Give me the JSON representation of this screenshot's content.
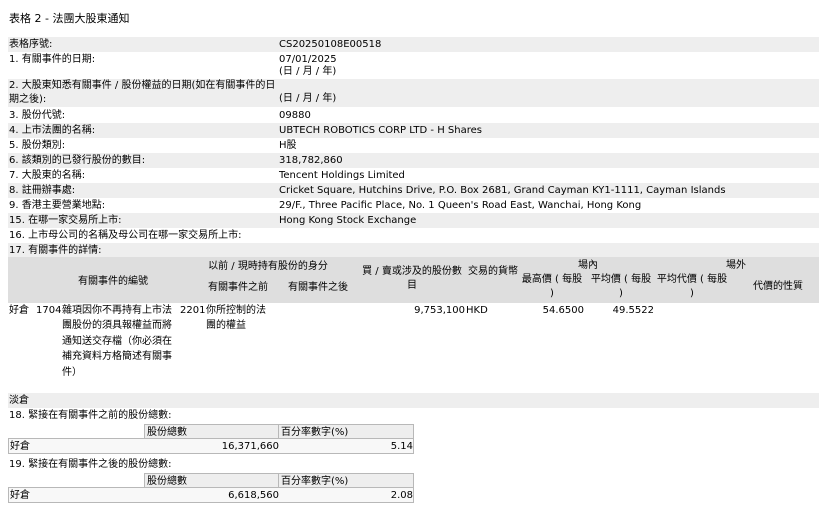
{
  "form_title": "表格 2 - 法團大股東通知",
  "fields": [
    {
      "label": "表格序號:",
      "value": "CS20250108E00518"
    },
    {
      "label": "1. 有關事件的日期:",
      "value": "07/01/2025",
      "sub": "(日 / 月 / 年)"
    },
    {
      "label": "2. 大股東知悉有關事件 / 股份權益的日期(如在有關事件的日期之後):",
      "value": "(日 / 月 / 年)"
    },
    {
      "label": "3. 股份代號:",
      "value": "09880"
    },
    {
      "label": "4. 上市法團的名稱:",
      "value": "UBTECH ROBOTICS CORP LTD - H Shares"
    },
    {
      "label": "5. 股份類別:",
      "value": "H股"
    },
    {
      "label": "6. 該類別的已發行股份的數目:",
      "value": "318,782,860"
    },
    {
      "label": "7. 大股東的名稱:",
      "value": "Tencent Holdings Limited"
    },
    {
      "label": "8. 註冊辦事處:",
      "value": "Cricket Square, Hutchins Drive, P.O. Box 2681, Grand Cayman KY1-1111, Cayman Islands"
    },
    {
      "label": "9. 香港主要營業地點:",
      "value": "29/F., Three Pacific Place, No. 1 Queen's Road East, Wanchai, Hong Kong"
    },
    {
      "label": "15. 在哪一家交易所上市:",
      "value": "Hong Kong Stock Exchange"
    },
    {
      "label": "16. 上市母公司的名稱及母公司在哪一家交易所上市:",
      "value": ""
    },
    {
      "label": "17. 有關事件的詳情:",
      "value": ""
    }
  ],
  "event_table": {
    "headers": {
      "event_code": "有關事件的編號",
      "capacity_group": "以前 / 現時持有股份的身分",
      "before": "有關事件之前",
      "after": "有關事件之後",
      "shares_involved": "買 / 賣或涉及的股份數目",
      "currency": "交易的貨幣",
      "onex_group": "場內",
      "highest": "最高價 ( 每股 )",
      "average": "平均價 ( 每股 )",
      "offex_group": "場外",
      "offex_average": "平均代價 ( 每股 )",
      "consideration": "代價的性質"
    },
    "row": {
      "position": "好倉",
      "code": "1704",
      "description": "雜項因你不再持有上市法團股份的須具報權益而將通知送交存檔（你必須在補充資料方格簡述有關事件）",
      "capacity_code": "2201",
      "capacity_desc": "你所控制的法團的權益",
      "shares": "9,753,100",
      "currency": "HKD",
      "highest": "54.6500",
      "average": "49.5522"
    },
    "short_label": "淡倉"
  },
  "before_section": {
    "title": "18. 緊接在有關事件之前的股份總數:",
    "col_shares": "股份總數",
    "col_pct": "百分率數字(%)",
    "position": "好倉",
    "shares": "16,371,660",
    "pct": "5.14"
  },
  "after_section": {
    "title": "19. 緊接在有關事件之後的股份總數:",
    "col_shares": "股份總數",
    "col_pct": "百分率數字(%)",
    "position": "好倉",
    "shares": "6,618,560",
    "pct": "2.08"
  },
  "colors": {
    "shade": "#eeeeee",
    "header": "#dedede",
    "border": "#b8b8b8"
  }
}
